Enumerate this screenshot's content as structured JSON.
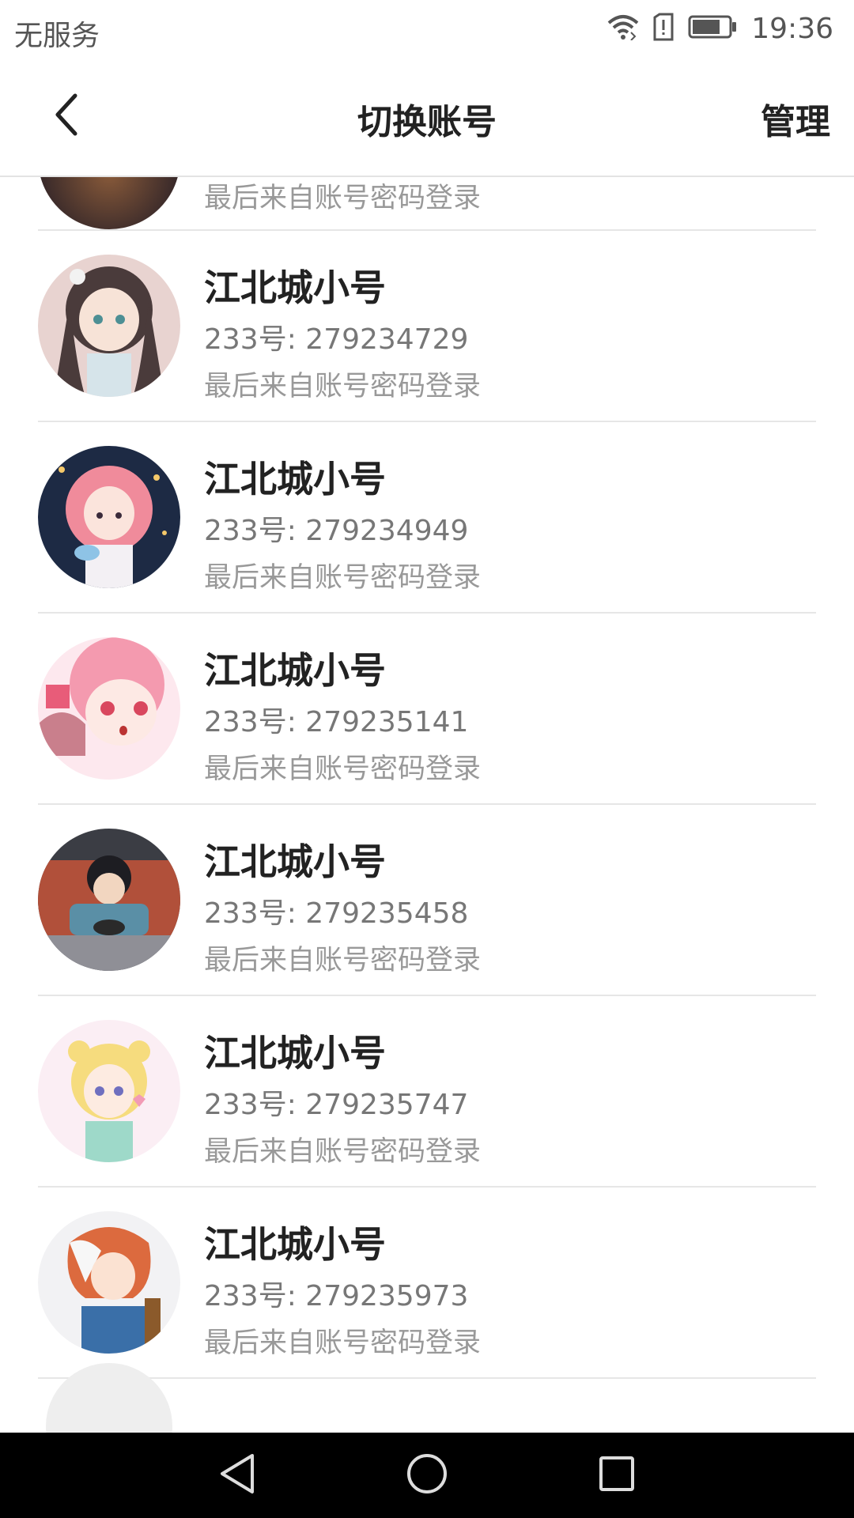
{
  "status_bar": {
    "carrier": "无服务",
    "time": "19:36",
    "icons": [
      "wifi-icon",
      "sim-alert-icon",
      "battery-icon"
    ]
  },
  "header": {
    "title": "切换账号",
    "manage_label": "管理",
    "back_icon": "chevron-left-icon"
  },
  "accounts": {
    "partial_top": {
      "last_login": "最后来自账号密码登录"
    },
    "items": [
      {
        "name": "江北城小号",
        "uid": "233号: 279234729",
        "last_login": "最后来自账号密码登录"
      },
      {
        "name": "江北城小号",
        "uid": "233号: 279234949",
        "last_login": "最后来自账号密码登录"
      },
      {
        "name": "江北城小号",
        "uid": "233号: 279235141",
        "last_login": "最后来自账号密码登录"
      },
      {
        "name": "江北城小号",
        "uid": "233号: 279235458",
        "last_login": "最后来自账号密码登录"
      },
      {
        "name": "江北城小号",
        "uid": "233号: 279235747",
        "last_login": "最后来自账号密码登录"
      },
      {
        "name": "江北城小号",
        "uid": "233号: 279235973",
        "last_login": "最后来自账号密码登录"
      }
    ]
  },
  "nav_bar": {
    "buttons": [
      "back-triangle-icon",
      "home-circle-icon",
      "recents-square-icon"
    ]
  }
}
